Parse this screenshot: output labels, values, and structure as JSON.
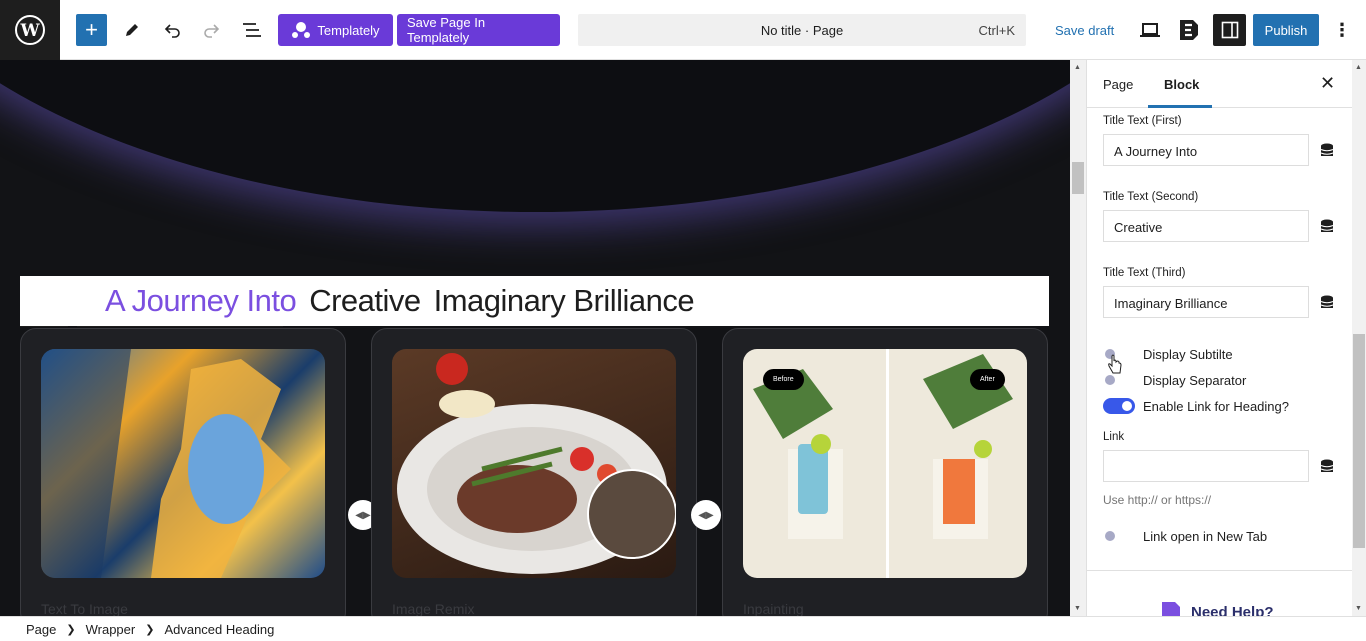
{
  "topbar": {
    "templately_label": "Templately",
    "save_in_templately_label": "Save Page In Templately",
    "document_title": "No title · Page",
    "shortcut": "Ctrl+K",
    "save_draft_label": "Save draft",
    "publish_label": "Publish"
  },
  "canvas": {
    "heading": {
      "first": "A Journey Into",
      "second": "Creative",
      "third": "Imaginary Brilliance"
    },
    "first_color": "#7b4fe0",
    "cards": [
      {
        "label": "Text To Image"
      },
      {
        "label": "Image Remix"
      },
      {
        "label": "Inpainting",
        "before_badge": "Before",
        "after_badge": "After"
      }
    ]
  },
  "sidebar": {
    "tabs": [
      "Page",
      "Block"
    ],
    "fields": [
      {
        "label": "Title Text (First)",
        "value": "A Journey Into"
      },
      {
        "label": "Title Text (Second)",
        "value": "Creative"
      },
      {
        "label": "Title Text (Third)",
        "value": "Imaginary Brilliance"
      }
    ],
    "toggles": [
      {
        "label": "Display Subtilte",
        "on": false
      },
      {
        "label": "Display Separator",
        "on": false
      },
      {
        "label": "Enable Link for Heading?",
        "on": true
      }
    ],
    "link_label": "Link",
    "link_value": "",
    "link_help": "Use http:// or https://",
    "new_tab_toggle": {
      "label": "Link open in New Tab",
      "on": false
    },
    "need_help": "Need Help?"
  },
  "breadcrumb": [
    "Page",
    "Wrapper",
    "Advanced Heading"
  ],
  "colors": {
    "accent": "#2271b1",
    "templately": "#6a3ad8",
    "toggle_on": "#3858e9"
  }
}
